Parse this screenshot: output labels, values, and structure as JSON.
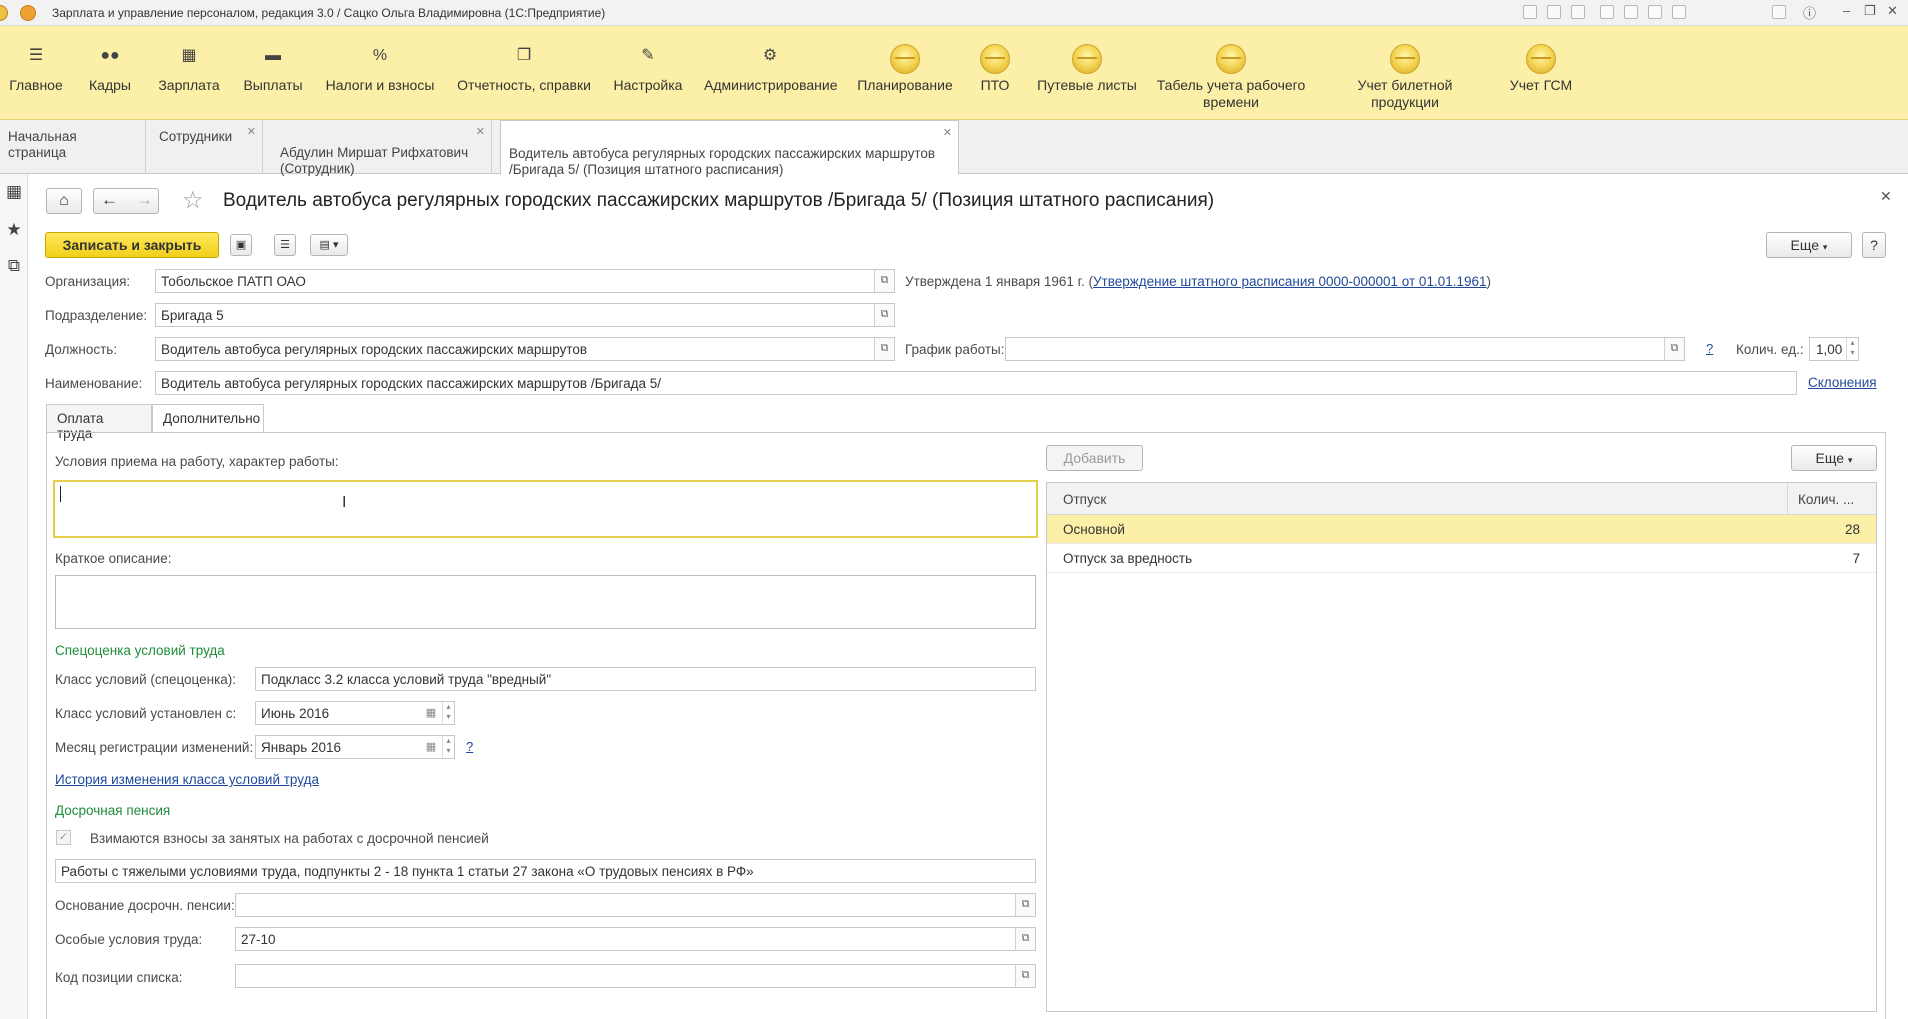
{
  "window": {
    "title": "Зарплата и управление персоналом, редакция 3.0 / Сацко Ольга Владимировна  (1С:Предприятие)",
    "controls": [
      "–",
      "❐",
      "✕"
    ]
  },
  "sections": [
    {
      "label": "Главное",
      "icon": "menu-icon",
      "glyph": "☰"
    },
    {
      "label": "Кадры",
      "icon": "people-icon",
      "glyph": "👥"
    },
    {
      "label": "Зарплата",
      "icon": "calculator-icon",
      "glyph": "▦"
    },
    {
      "label": "Выплаты",
      "icon": "wallet-icon",
      "glyph": "▬"
    },
    {
      "label": "Налоги и взносы",
      "icon": "percent-icon",
      "glyph": "%"
    },
    {
      "label": "Отчетность, справки",
      "icon": "report-icon",
      "glyph": "❐"
    },
    {
      "label": "Настройка",
      "icon": "wrench-icon",
      "glyph": "🔧"
    },
    {
      "label": "Администрирование",
      "icon": "gear-icon",
      "glyph": "⚙"
    },
    {
      "label": "Планирование",
      "icon": "default-section-icon"
    },
    {
      "label": "ПТО",
      "icon": "default-section-icon"
    },
    {
      "label": "Путевые листы",
      "icon": "default-section-icon"
    },
    {
      "label": "Табель учета рабочего\nвремени",
      "icon": "default-section-icon"
    },
    {
      "label": "Учет билетной продукции",
      "icon": "default-section-icon"
    },
    {
      "label": "Учет ГСМ",
      "icon": "default-section-icon"
    }
  ],
  "open_tabs": [
    {
      "label": "Начальная страница"
    },
    {
      "label": "Сотрудники"
    },
    {
      "label": "Абдулин Миршат Рифхатович\n(Сотрудник)"
    },
    {
      "label": "Водитель автобуса регулярных городских пассажирских маршрутов\n/Бригада 5/ (Позиция штатного расписания)"
    }
  ],
  "form": {
    "title": "Водитель автобуса регулярных городских пассажирских маршрутов /Бригада 5/ (Позиция штатного расписания)",
    "save_close": "Записать и закрыть",
    "more": "Еще",
    "help": "?",
    "org_label": "Организация:",
    "org_value": "Тобольское ПАТП ОАО",
    "approved_text": "Утверждена 1 января 1961 г. (",
    "approved_link": "Утверждение штатного расписания 0000-000001 от 01.01.1961",
    "approved_close": ")",
    "dept_label": "Подразделение:",
    "dept_value": "Бригада 5",
    "position_label": "Должность:",
    "position_value": "Водитель автобуса регулярных городских пассажирских маршрутов",
    "schedule_label": "График работы:",
    "schedule_value": "",
    "qty_label": "Колич. ед.:",
    "qty_value": "1,00",
    "name_label": "Наименование:",
    "name_value": "Водитель автобуса регулярных городских пассажирских маршрутов /Бригада 5/",
    "declension_link": "Склонения",
    "tabs": [
      "Оплата труда",
      "Дополнительно"
    ],
    "conditions_label": "Условия приема на работу, характер работы:",
    "conditions_value": "",
    "short_desc_label": "Краткое описание:",
    "short_desc_value": "",
    "special_header": "Спецоценка условий труда",
    "class_label": "Класс условий (спецоценка):",
    "class_value": "Подкласс 3.2 класса условий труда \"вредный\"",
    "class_since_label": "Класс условий установлен с:",
    "class_since_value": "Июнь 2016",
    "reg_month_label": "Месяц регистрации изменений:",
    "reg_month_value": "Январь 2016",
    "history_link": "История изменения класса условий труда",
    "pension_header": "Досрочная пенсия",
    "contrib_checkbox": "Взимаются взносы за занятых на работах с досрочной пенсией",
    "contrib_checked": true,
    "works_value": "Работы с тяжелыми условиями труда, подпункты 2 - 18 пункта 1 статьи 27 закона «О трудовых пенсиях в РФ»",
    "basis_label": "Основание досрочн. пенсии:",
    "basis_value": "",
    "special_cond_label": "Особые условия труда:",
    "special_cond_value": "27-10",
    "list_code_label": "Код позиции списка:",
    "list_code_value": ""
  },
  "vacation": {
    "add_button": "Добавить",
    "more": "Еще",
    "columns": [
      "Отпуск",
      "Колич. ..."
    ],
    "rows": [
      {
        "name": "Основной",
        "days": "28",
        "selected": true
      },
      {
        "name": "Отпуск за вредность",
        "days": "7",
        "selected": false
      }
    ]
  },
  "colors": {
    "sections_bg": "#fcf0a8",
    "accent_yellow": "#f1cf19",
    "link": "#1f4a9a",
    "group_header": "#1f8c3a"
  }
}
